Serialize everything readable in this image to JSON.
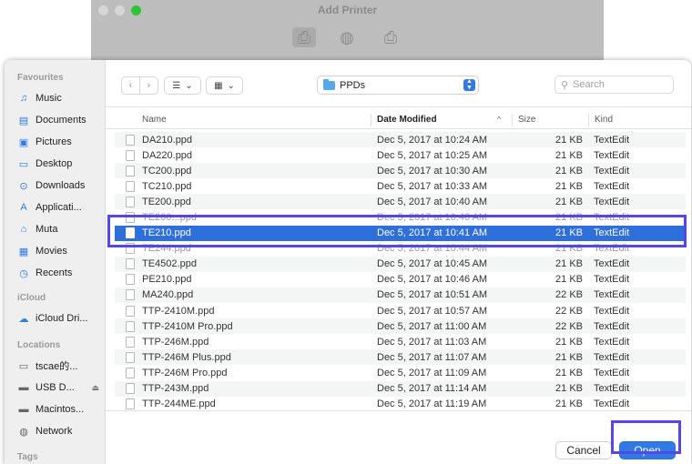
{
  "background_window": {
    "title": "Add Printer"
  },
  "sidebar": {
    "sections": [
      {
        "label": "Favourites",
        "items": [
          {
            "label": "Music",
            "icon": "music-icon"
          },
          {
            "label": "Documents",
            "icon": "document-icon"
          },
          {
            "label": "Pictures",
            "icon": "pictures-icon"
          },
          {
            "label": "Desktop",
            "icon": "desktop-icon"
          },
          {
            "label": "Downloads",
            "icon": "download-icon"
          },
          {
            "label": "Applicati...",
            "icon": "applications-icon"
          },
          {
            "label": "Muta",
            "icon": "home-icon"
          },
          {
            "label": "Movies",
            "icon": "movies-icon"
          },
          {
            "label": "Recents",
            "icon": "clock-icon"
          }
        ]
      },
      {
        "label": "iCloud",
        "items": [
          {
            "label": "iCloud Dri...",
            "icon": "cloud-icon"
          }
        ]
      },
      {
        "label": "Locations",
        "items": [
          {
            "label": "tscae的...",
            "icon": "laptop-icon"
          },
          {
            "label": "USB D...",
            "icon": "drive-icon"
          },
          {
            "label": "Macintos...",
            "icon": "drive-icon"
          },
          {
            "label": "Network",
            "icon": "globe-icon"
          }
        ]
      },
      {
        "label": "Tags",
        "items": []
      }
    ]
  },
  "toolbar": {
    "path": "PPDs",
    "search_placeholder": "Search"
  },
  "table": {
    "headers": {
      "name": "Name",
      "date": "Date Modified",
      "size": "Size",
      "kind": "Kind"
    },
    "rows": [
      {
        "name": "DA210.ppd",
        "date": "Dec 5, 2017 at 10:24 AM",
        "size": "21 KB",
        "kind": "TextEdit"
      },
      {
        "name": "DA220.ppd",
        "date": "Dec 5, 2017 at 10:25 AM",
        "size": "21 KB",
        "kind": "TextEdit"
      },
      {
        "name": "TC200.ppd",
        "date": "Dec 5, 2017 at 10:30 AM",
        "size": "21 KB",
        "kind": "TextEdit"
      },
      {
        "name": "TC210.ppd",
        "date": "Dec 5, 2017 at 10:33 AM",
        "size": "21 KB",
        "kind": "TextEdit"
      },
      {
        "name": "TE200.ppd",
        "date": "Dec 5, 2017 at 10:40 AM",
        "size": "21 KB",
        "kind": "TextEdit"
      },
      {
        "name": "TE200...ppd",
        "date": "Dec 5, 2017 at 10:40 AM",
        "size": "21 KB",
        "kind": "TextEdit",
        "cut": true
      },
      {
        "name": "TE210.ppd",
        "date": "Dec 5, 2017 at 10:41 AM",
        "size": "21 KB",
        "kind": "TextEdit",
        "selected": true
      },
      {
        "name": "TE244.ppd",
        "date": "Dec 5, 2017 at 10:44 AM",
        "size": "21 KB",
        "kind": "TextEdit",
        "cut": true
      },
      {
        "name": "TE4502.ppd",
        "date": "Dec 5, 2017 at 10:45 AM",
        "size": "21 KB",
        "kind": "TextEdit"
      },
      {
        "name": "PE210.ppd",
        "date": "Dec 5, 2017 at 10:46 AM",
        "size": "21 KB",
        "kind": "TextEdit"
      },
      {
        "name": "MA240.ppd",
        "date": "Dec 5, 2017 at 10:51 AM",
        "size": "22 KB",
        "kind": "TextEdit"
      },
      {
        "name": "TTP-2410M.ppd",
        "date": "Dec 5, 2017 at 10:57 AM",
        "size": "22 KB",
        "kind": "TextEdit"
      },
      {
        "name": "TTP-2410M Pro.ppd",
        "date": "Dec 5, 2017 at 11:00 AM",
        "size": "22 KB",
        "kind": "TextEdit"
      },
      {
        "name": "TTP-246M.ppd",
        "date": "Dec 5, 2017 at 11:03 AM",
        "size": "21 KB",
        "kind": "TextEdit"
      },
      {
        "name": "TTP-246M Plus.ppd",
        "date": "Dec 5, 2017 at 11:07 AM",
        "size": "21 KB",
        "kind": "TextEdit"
      },
      {
        "name": "TTP-246M Pro.ppd",
        "date": "Dec 5, 2017 at 11:09 AM",
        "size": "21 KB",
        "kind": "TextEdit"
      },
      {
        "name": "TTP-243M.ppd",
        "date": "Dec 5, 2017 at 11:14 AM",
        "size": "21 KB",
        "kind": "TextEdit"
      },
      {
        "name": "TTP-244ME.ppd",
        "date": "Dec 5, 2017 at 11:19 AM",
        "size": "21 KB",
        "kind": "TextEdit"
      }
    ]
  },
  "footer": {
    "cancel_label": "Cancel",
    "open_label": "Open"
  },
  "colors": {
    "accent": "#2f7ae5",
    "selection": "#2f6fdc",
    "annotation": "#5746e6"
  }
}
